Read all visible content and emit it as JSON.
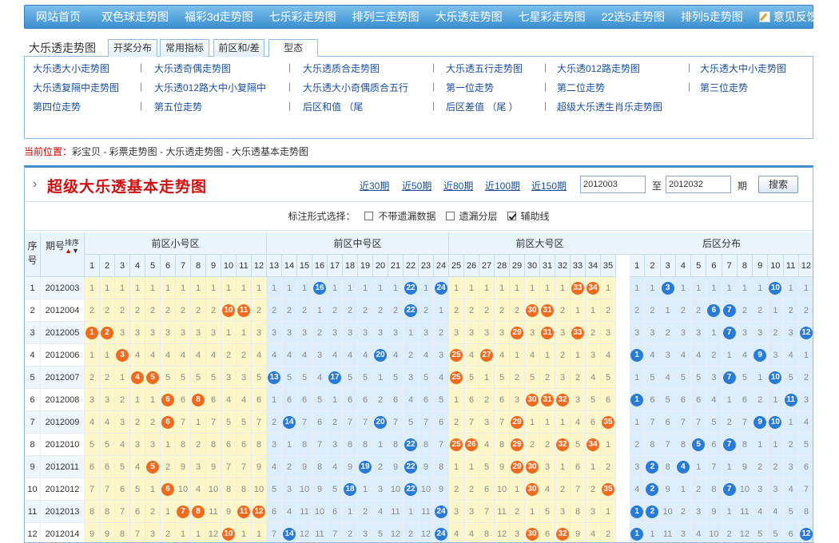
{
  "nav": [
    "网站首页",
    "双色球走势图",
    "福彩3d走势图",
    "七乐彩走势图",
    "排列三走势图",
    "大乐透走势图",
    "七星彩走势图",
    "22选5走势图",
    "排列5走势图"
  ],
  "nav_feedback": "意见反馈",
  "tabs": {
    "label": "大乐透走势图",
    "items": [
      "开奖分布",
      "常用指标",
      "前区和/差",
      "型态"
    ]
  },
  "links": [
    [
      "大乐透大小走势图",
      "大乐透奇偶走势图",
      "大乐透质合走势图",
      "大乐透五行走势图",
      "大乐透012路走势图",
      "大乐透大中小走势图"
    ],
    [
      "大乐透复隔中走势图",
      "大乐透012路大中小复隔中",
      "大乐透大小奇偶质合五行",
      "第一位走势",
      "第二位走势",
      "第三位走势"
    ],
    [
      "第四位走势",
      "第五位走势",
      "后区和值 （尾",
      "后区差值 （尾 ）",
      "超级大乐透生肖乐走势图",
      ""
    ]
  ],
  "links_sep": "|",
  "crumb": {
    "label": "当前位置：",
    "path": "彩宝贝 - 彩票走势图 - 大乐透走势图 - 大乐透基本走势图"
  },
  "main": {
    "title": "超级大乐透基本走势图",
    "periods": [
      "近30期",
      "近50期",
      "近80期",
      "近100期",
      "近150期"
    ],
    "from": "2012003",
    "to_label": "至",
    "to": "2012032",
    "qi": "期",
    "search": "搜索"
  },
  "options": {
    "label": "标注形式选择：",
    "items": [
      {
        "label": "不带遗漏数据",
        "checked": false
      },
      {
        "label": "遗漏分层",
        "checked": false
      },
      {
        "label": "辅助线",
        "checked": true
      }
    ]
  },
  "table": {
    "col_seq": "序号",
    "col_issue": "期号",
    "col_sort": "排序",
    "groups": [
      "前区小号区",
      "前区中号区",
      "前区大号区",
      "后区分布"
    ],
    "numbers_front": [
      1,
      2,
      3,
      4,
      5,
      6,
      7,
      8,
      9,
      10,
      11,
      12,
      13,
      14,
      15,
      16,
      17,
      18,
      19,
      20,
      21,
      22,
      23,
      24,
      25,
      26,
      27,
      28,
      29,
      30,
      31,
      32,
      33,
      34,
      35
    ],
    "numbers_back": [
      1,
      2,
      3,
      4,
      5,
      6,
      7,
      8,
      9,
      10,
      11,
      12
    ],
    "rows": [
      {
        "seq": "1",
        "issue": "2012003",
        "f": [
          1,
          1,
          1,
          1,
          1,
          1,
          1,
          1,
          1,
          1,
          1,
          1,
          1,
          1,
          1,
          0,
          1,
          1,
          1,
          1,
          1,
          0,
          1,
          0,
          1,
          1,
          1,
          1,
          1,
          1,
          1,
          1,
          0,
          0,
          1
        ],
        "b": [
          1,
          1,
          0,
          1,
          1,
          1,
          1,
          1,
          1,
          0,
          1,
          1
        ]
      },
      {
        "seq": "2",
        "issue": "2012004",
        "f": [
          2,
          2,
          2,
          2,
          2,
          2,
          2,
          2,
          2,
          0,
          0,
          2,
          2,
          2,
          2,
          1,
          2,
          2,
          2,
          2,
          2,
          0,
          2,
          1,
          2,
          2,
          2,
          2,
          2,
          0,
          0,
          2,
          1,
          1,
          2
        ],
        "b": [
          2,
          2,
          1,
          2,
          2,
          0,
          0,
          2,
          2,
          1,
          2,
          2
        ]
      },
      {
        "seq": "3",
        "issue": "2012005",
        "f": [
          0,
          0,
          3,
          3,
          3,
          3,
          3,
          3,
          3,
          1,
          1,
          3,
          3,
          3,
          3,
          2,
          3,
          3,
          3,
          3,
          3,
          1,
          3,
          2,
          3,
          3,
          3,
          3,
          0,
          3,
          0,
          3,
          0,
          2,
          3
        ],
        "b": [
          3,
          3,
          2,
          3,
          3,
          1,
          0,
          3,
          3,
          2,
          3,
          0
        ]
      },
      {
        "seq": "4",
        "issue": "2012006",
        "f": [
          1,
          1,
          0,
          4,
          4,
          4,
          4,
          4,
          4,
          2,
          2,
          4,
          4,
          4,
          4,
          3,
          4,
          4,
          4,
          0,
          4,
          2,
          4,
          3,
          0,
          4,
          0,
          4,
          1,
          4,
          1,
          2,
          1,
          3,
          4
        ],
        "b": [
          0,
          4,
          3,
          4,
          4,
          2,
          1,
          4,
          0,
          3,
          4,
          1
        ]
      },
      {
        "seq": "5",
        "issue": "2012007",
        "f": [
          2,
          2,
          1,
          0,
          0,
          5,
          5,
          5,
          5,
          3,
          3,
          5,
          0,
          5,
          5,
          4,
          0,
          5,
          5,
          1,
          5,
          3,
          5,
          4,
          0,
          5,
          1,
          5,
          2,
          5,
          2,
          3,
          2,
          4,
          5
        ],
        "b": [
          1,
          5,
          4,
          5,
          5,
          3,
          0,
          5,
          1,
          0,
          5,
          2
        ]
      },
      {
        "seq": "6",
        "issue": "2012008",
        "f": [
          3,
          3,
          2,
          1,
          1,
          0,
          6,
          0,
          6,
          4,
          4,
          6,
          1,
          6,
          6,
          5,
          1,
          6,
          6,
          2,
          6,
          4,
          6,
          5,
          1,
          6,
          2,
          6,
          3,
          0,
          0,
          0,
          3,
          5,
          6
        ],
        "b": [
          0,
          6,
          5,
          6,
          6,
          4,
          1,
          6,
          2,
          1,
          0,
          3
        ]
      },
      {
        "seq": "7",
        "issue": "2012009",
        "f": [
          4,
          4,
          3,
          2,
          2,
          0,
          7,
          1,
          7,
          5,
          5,
          7,
          2,
          0,
          7,
          6,
          2,
          7,
          7,
          0,
          7,
          5,
          7,
          6,
          2,
          7,
          3,
          7,
          0,
          1,
          1,
          1,
          4,
          6,
          0
        ],
        "b": [
          1,
          7,
          6,
          7,
          7,
          5,
          2,
          7,
          0,
          0,
          1,
          4
        ]
      },
      {
        "seq": "8",
        "issue": "2012010",
        "f": [
          5,
          5,
          4,
          3,
          3,
          1,
          8,
          2,
          8,
          6,
          6,
          8,
          3,
          1,
          8,
          7,
          3,
          8,
          8,
          1,
          8,
          0,
          8,
          7,
          0,
          0,
          4,
          8,
          0,
          2,
          2,
          0,
          5,
          0,
          1
        ],
        "b": [
          2,
          8,
          7,
          8,
          0,
          6,
          0,
          8,
          1,
          1,
          2,
          5
        ]
      },
      {
        "seq": "9",
        "issue": "2012011",
        "f": [
          6,
          6,
          5,
          4,
          0,
          2,
          9,
          3,
          9,
          7,
          7,
          9,
          4,
          2,
          9,
          8,
          4,
          9,
          0,
          2,
          9,
          0,
          9,
          8,
          1,
          1,
          5,
          9,
          0,
          0,
          3,
          1,
          6,
          1,
          2
        ],
        "b": [
          3,
          0,
          8,
          0,
          1,
          7,
          1,
          9,
          2,
          2,
          3,
          6
        ]
      },
      {
        "seq": "10",
        "issue": "2012012",
        "f": [
          7,
          7,
          6,
          5,
          1,
          0,
          10,
          4,
          10,
          8,
          8,
          10,
          5,
          3,
          10,
          9,
          5,
          0,
          1,
          3,
          10,
          0,
          10,
          9,
          2,
          2,
          6,
          10,
          1,
          0,
          4,
          2,
          7,
          2,
          0
        ],
        "b": [
          4,
          0,
          9,
          1,
          2,
          8,
          0,
          10,
          3,
          3,
          4,
          7
        ]
      },
      {
        "seq": "11",
        "issue": "2012013",
        "f": [
          8,
          8,
          7,
          6,
          2,
          1,
          0,
          0,
          11,
          9,
          0,
          0,
          6,
          4,
          11,
          10,
          6,
          1,
          2,
          4,
          11,
          1,
          11,
          0,
          3,
          3,
          7,
          11,
          2,
          1,
          5,
          3,
          8,
          3,
          1
        ],
        "b": [
          0,
          0,
          10,
          2,
          3,
          9,
          1,
          11,
          4,
          4,
          5,
          8
        ]
      },
      {
        "seq": "12",
        "issue": "2012014",
        "f": [
          9,
          9,
          8,
          7,
          3,
          2,
          1,
          1,
          12,
          0,
          1,
          1,
          7,
          0,
          12,
          11,
          7,
          2,
          3,
          5,
          12,
          2,
          12,
          0,
          4,
          4,
          8,
          12,
          3,
          0,
          6,
          0,
          9,
          4,
          2
        ],
        "b": [
          0,
          1,
          11,
          3,
          4,
          10,
          2,
          12,
          5,
          5,
          6,
          0
        ]
      }
    ]
  },
  "colors": {
    "nav": "#3b8fd0",
    "title_red": "#d01010",
    "link_blue": "#1a4f9c",
    "ball_orange": "#f06a20",
    "ball_blue": "#2a7ad8",
    "zone_yellow": "#fdf6c8",
    "zone_blue": "#dcedfb"
  }
}
